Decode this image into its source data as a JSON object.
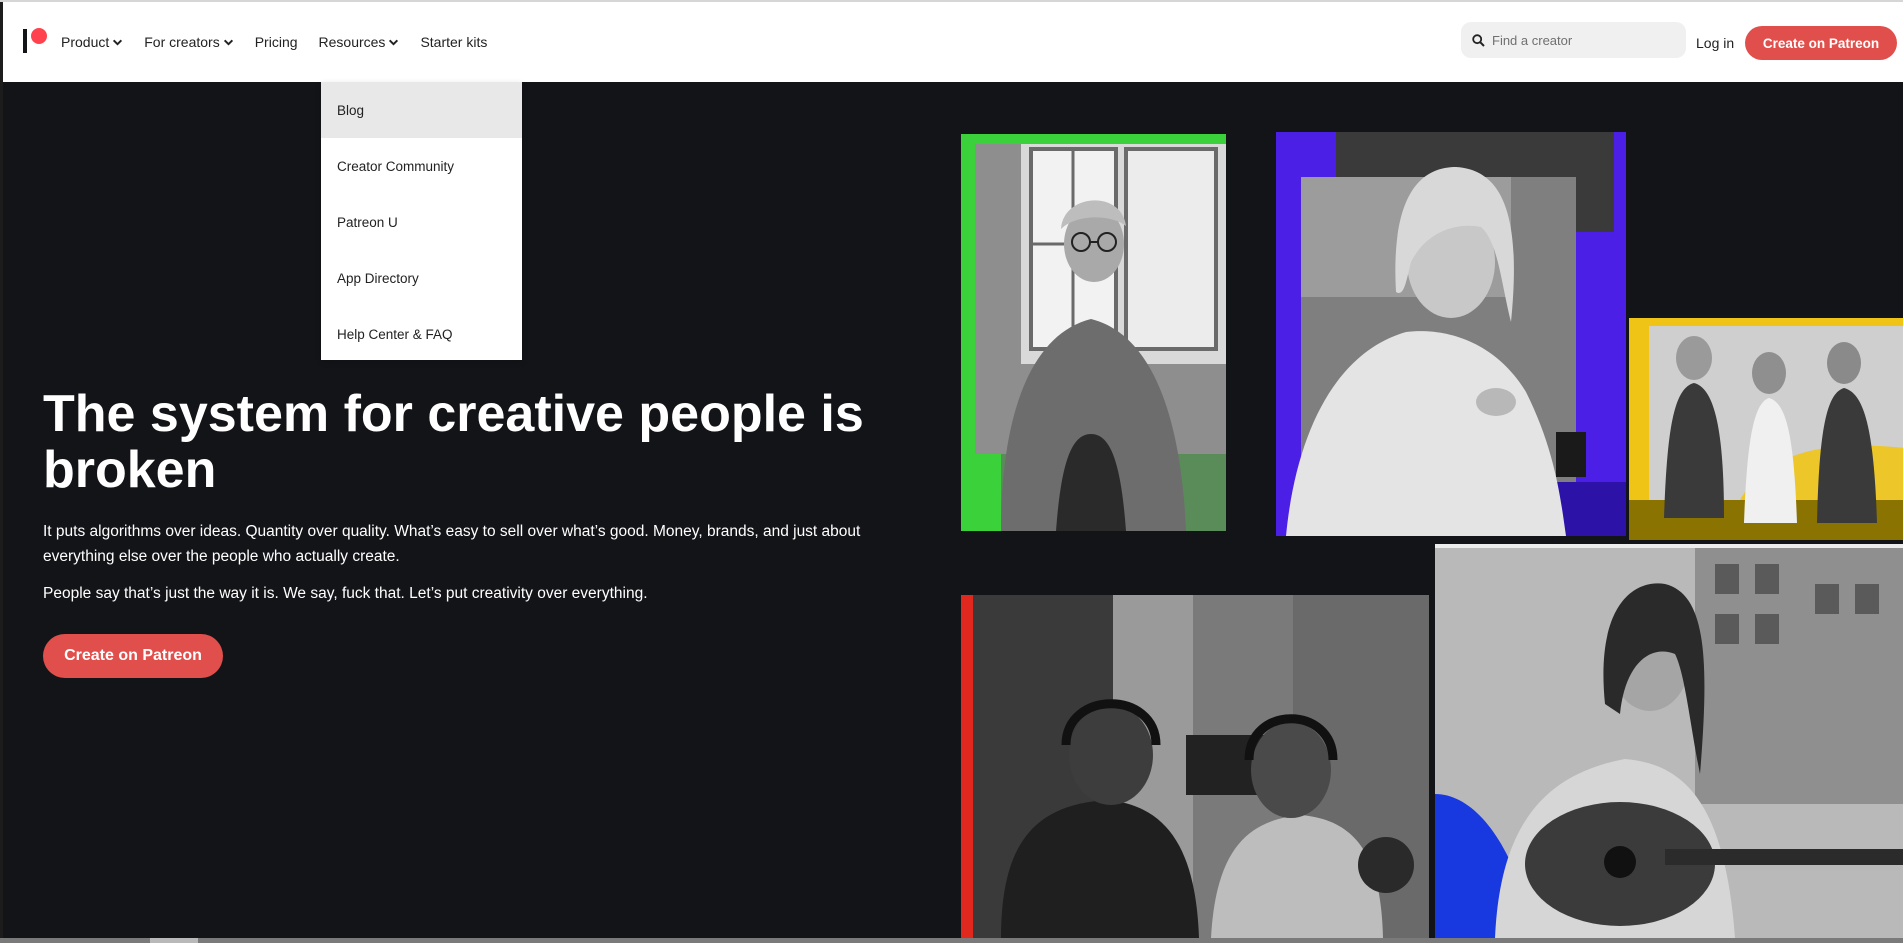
{
  "header": {
    "nav": {
      "product": "Product",
      "for_creators": "For creators",
      "pricing": "Pricing",
      "resources": "Resources",
      "starter_kits": "Starter kits"
    },
    "search_placeholder": "Find a creator",
    "login": "Log in",
    "create_button": "Create on Patreon"
  },
  "resources_menu": {
    "items": [
      "Blog",
      "Creator Community",
      "Patreon U",
      "App Directory",
      "Help Center & FAQ"
    ],
    "highlighted": "Blog"
  },
  "hero": {
    "headline": "The system for creative people is broken",
    "paragraph1": "It puts algorithms over ideas. Quantity over quality. What’s easy to sell over what’s good. Money, brands, and just about everything else over the people who actually create.",
    "paragraph2": "People say that’s just the way it is. We say, fuck that. Let’s put creativity over everything.",
    "cta": "Create on Patreon"
  },
  "colors": {
    "brand_red": "#e04f4b",
    "logo_coral": "#ff424d",
    "hero_background": "#131418",
    "accent_green": "#3bd13b",
    "accent_purple": "#4b1fe6",
    "accent_yellow": "#f0c416",
    "accent_blue": "#1838e0",
    "accent_red": "#e0281f"
  }
}
